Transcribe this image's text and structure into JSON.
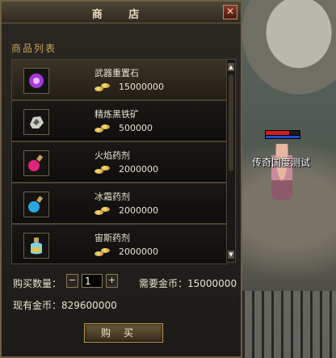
{
  "window": {
    "title": "商 店",
    "section_label": "商品列表",
    "close_glyph": "✕"
  },
  "items": [
    {
      "name": "武器重置石",
      "price": "15000000",
      "icon": "purple-gem-icon"
    },
    {
      "name": "精炼黑铁矿",
      "price": "500000",
      "icon": "iron-ore-icon"
    },
    {
      "name": "火焰药剂",
      "price": "2000000",
      "icon": "red-potion-icon"
    },
    {
      "name": "冰霜药剂",
      "price": "2000000",
      "icon": "blue-potion-icon"
    },
    {
      "name": "宙斯药剂",
      "price": "2000000",
      "icon": "yellow-potion-icon"
    }
  ],
  "purchase": {
    "qty_label": "购买数量：",
    "qty_value": "1",
    "minus": "−",
    "plus": "+",
    "need_label": "需要金币：15000000",
    "have_label": "现有金币：829600000",
    "buy_label": "购买"
  },
  "npc": {
    "name": "传奇国度测试"
  },
  "colors": {
    "accent": "#c9a15a",
    "border": "#6e5e42",
    "hp": "#d02020",
    "mp": "#2050d0"
  }
}
